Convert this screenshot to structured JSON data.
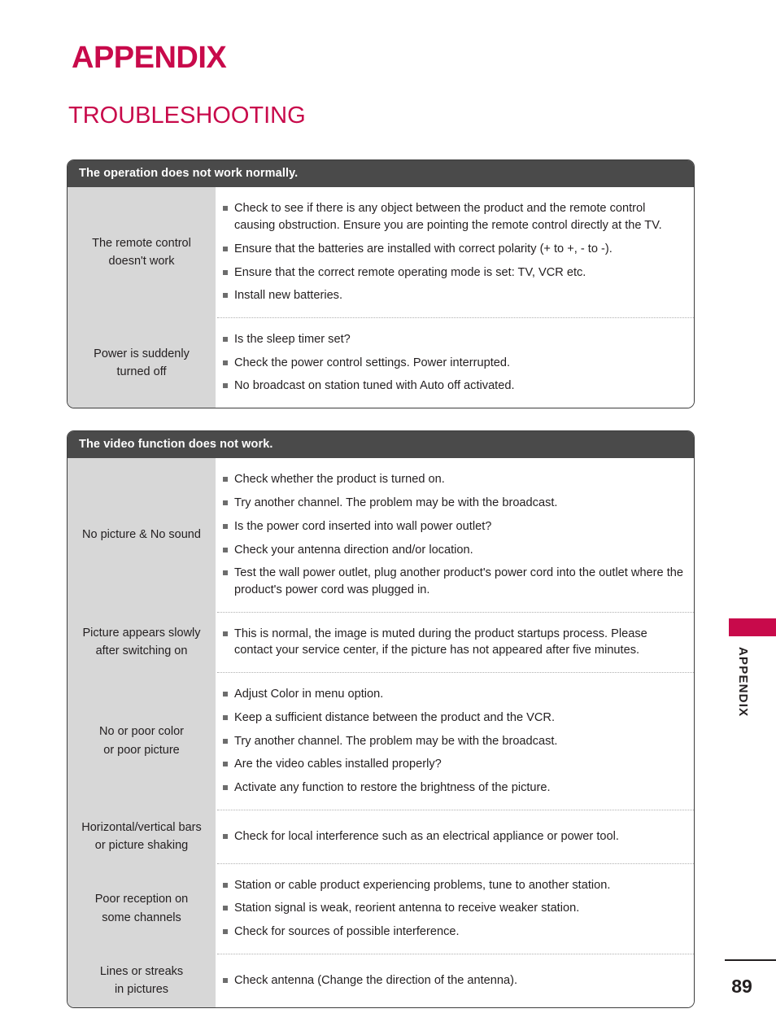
{
  "page": {
    "title": "APPENDIX",
    "section_title": "TROUBLESHOOTING",
    "side_label": "APPENDIX",
    "page_number": "89",
    "accent_color": "#c80a4b",
    "header_bar_color": "#4a4a4a",
    "label_cell_color": "#d7d7d7"
  },
  "tables": [
    {
      "header": "The operation does not work normally.",
      "rows": [
        {
          "label_lines": [
            "The remote control",
            "doesn't work"
          ],
          "items": [
            "Check to see if there is any object between the product and the remote control causing obstruction. Ensure you are pointing the remote control directly at the TV.",
            "Ensure that the batteries are installed with correct polarity (+ to +, - to -).",
            "Ensure that the correct remote operating mode is set: TV, VCR etc.",
            "Install new batteries."
          ]
        },
        {
          "label_lines": [
            "Power is suddenly",
            "turned off"
          ],
          "items": [
            "Is the sleep timer set?",
            "Check the power control settings. Power interrupted.",
            "No broadcast on station tuned with Auto off activated."
          ]
        }
      ]
    },
    {
      "header": "The video function does not work.",
      "rows": [
        {
          "label_lines": [
            "No picture & No sound"
          ],
          "items": [
            "Check whether the product is turned on.",
            "Try another channel. The problem may be with the broadcast.",
            "Is the power cord inserted into wall power outlet?",
            "Check your antenna direction and/or location.",
            "Test the wall power outlet, plug another product's power cord into the outlet where the product's power cord was plugged in."
          ]
        },
        {
          "label_lines": [
            "Picture appears slowly",
            "after switching on"
          ],
          "items": [
            "This is normal, the image is muted during the product startups process. Please contact your service center, if the picture has not appeared after five minutes."
          ]
        },
        {
          "label_lines": [
            "No or poor color",
            "or poor picture"
          ],
          "items": [
            "Adjust Color in menu option.",
            "Keep a sufficient distance between the product and the VCR.",
            "Try another channel. The problem may be with the broadcast.",
            "Are the video cables installed properly?",
            "Activate any function to restore the brightness of the picture."
          ]
        },
        {
          "label_lines": [
            "Horizontal/vertical bars",
            "or picture shaking"
          ],
          "items": [
            "Check for local interference such as an electrical appliance or power tool."
          ]
        },
        {
          "label_lines": [
            "Poor reception on",
            "some channels"
          ],
          "items": [
            "Station or cable product experiencing problems, tune to another station.",
            "Station signal is weak, reorient antenna to receive weaker station.",
            "Check for sources of possible interference."
          ]
        },
        {
          "label_lines": [
            "Lines or streaks",
            "in pictures"
          ],
          "items": [
            "Check antenna (Change the direction of the antenna)."
          ]
        }
      ]
    }
  ]
}
